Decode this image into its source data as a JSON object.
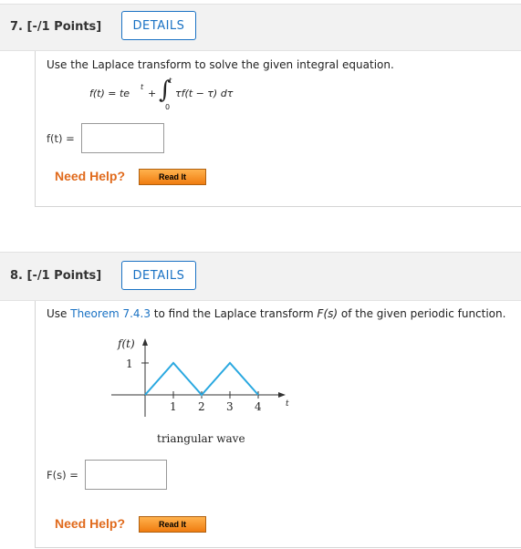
{
  "q7": {
    "number": "7.",
    "points": "[-/1 Points]",
    "details": "DETAILS",
    "prompt": "Use the Laplace transform to solve the given integral equation.",
    "eq_lhs": "f(t) = te",
    "eq_sup": "t",
    "eq_plus": "+",
    "eq_upper": "t",
    "eq_lower": "0",
    "eq_integrand": "τf(t − τ) dτ",
    "answer_label": "f(t) =",
    "answer_value": "",
    "need_help": "Need Help?",
    "read_it": "Read It"
  },
  "q8": {
    "number": "8.",
    "points": "[-/1 Points]",
    "details": "DETAILS",
    "prompt_pre": "Use ",
    "prompt_link": "Theorem 7.4.3",
    "prompt_post": " to find the Laplace transform ",
    "prompt_F": "F(s)",
    "prompt_end": " of the given periodic function.",
    "graph": {
      "y_label": "f(t)",
      "y_tick": "1",
      "x_ticks": [
        "1",
        "2",
        "3",
        "4"
      ],
      "x_axis_label": "t",
      "caption": "triangular wave",
      "wave_color": "#29a8e0",
      "wave_points": [
        [
          0,
          0
        ],
        [
          1,
          1
        ],
        [
          2,
          0
        ],
        [
          3,
          1
        ],
        [
          4,
          0
        ]
      ]
    },
    "answer_label": "F(s) =",
    "answer_value": "",
    "need_help": "Need Help?",
    "read_it": "Read It"
  }
}
